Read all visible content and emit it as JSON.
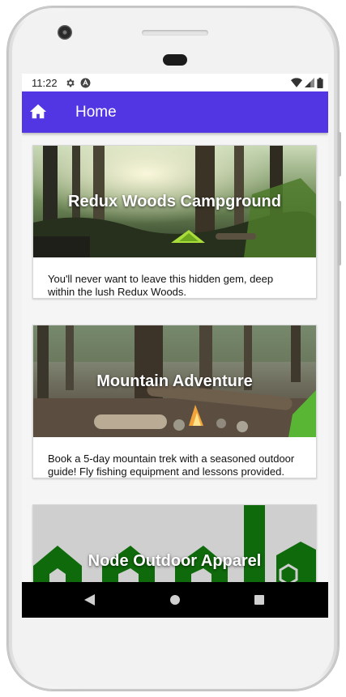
{
  "status_bar": {
    "time": "11:22",
    "icons_left": [
      "gear-icon",
      "a-badge-icon"
    ],
    "icons_right": [
      "wifi-icon",
      "signal-icon",
      "battery-icon"
    ]
  },
  "app_bar": {
    "title": "Home",
    "icon": "home-icon",
    "color": "#5336e3"
  },
  "cards": [
    {
      "title": "Redux Woods Campground",
      "description": "You'll never want to leave this hidden gem, deep within the lush Redux Woods."
    },
    {
      "title": "Mountain Adventure",
      "description": "Book a 5-day mountain trek with a seasoned outdoor guide! Fly fishing equipment and lessons provided."
    },
    {
      "title": "Node Outdoor Apparel",
      "description": ""
    }
  ],
  "nav_bar": {
    "buttons": [
      "back-icon",
      "home-circle-icon",
      "recents-square-icon"
    ]
  }
}
